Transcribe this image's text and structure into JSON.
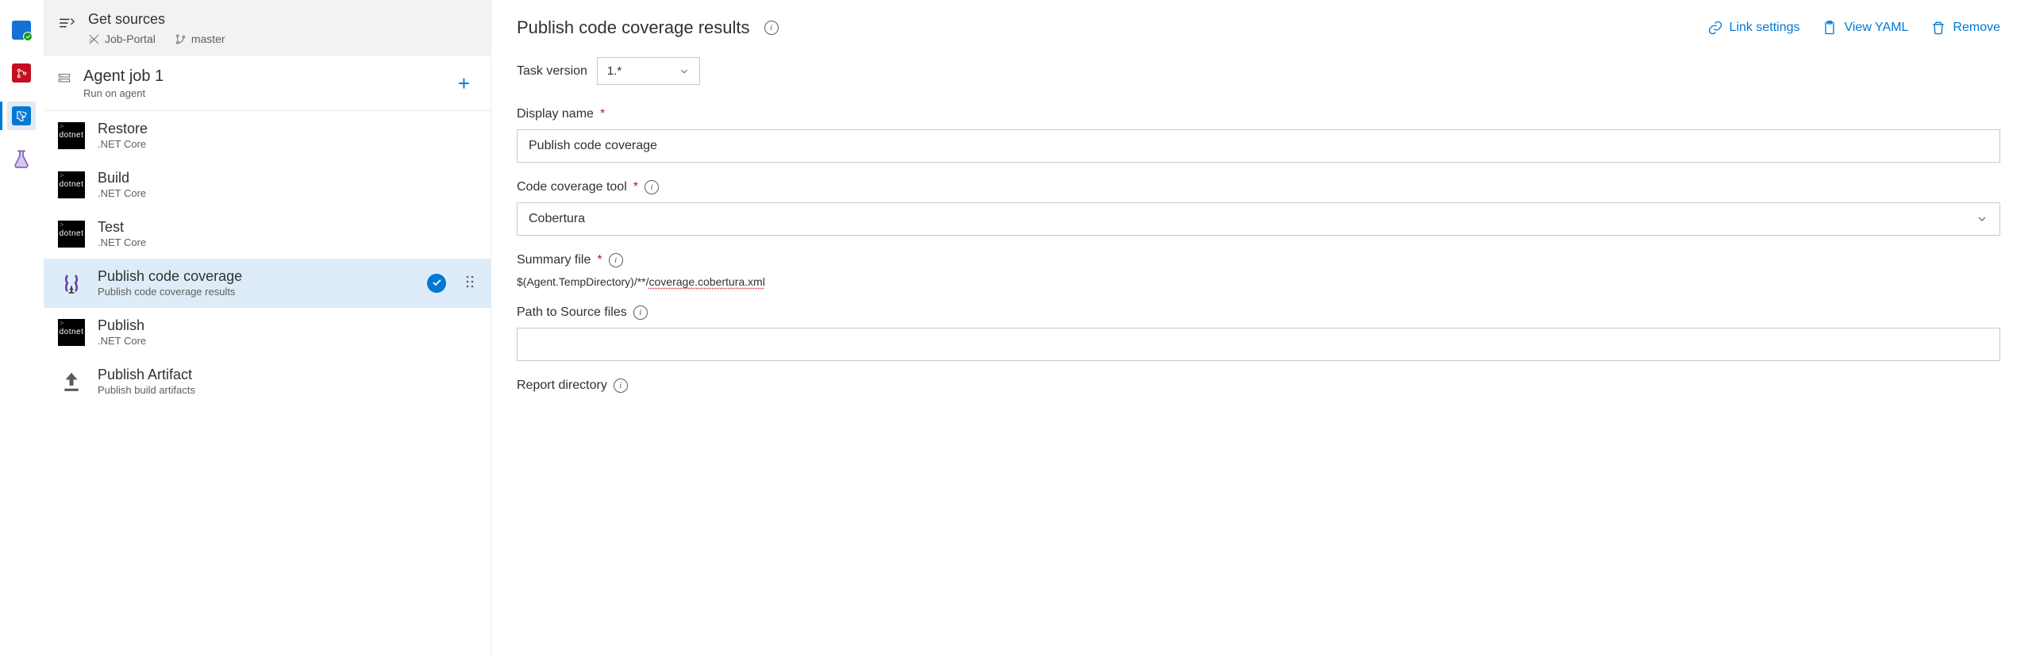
{
  "nav": {
    "items": [
      {
        "name": "overview"
      },
      {
        "name": "repos"
      },
      {
        "name": "pipelines"
      },
      {
        "name": "test-plans"
      }
    ]
  },
  "sources": {
    "title": "Get sources",
    "repo": "Job-Portal",
    "branch": "master"
  },
  "agentJob": {
    "title": "Agent job 1",
    "subtitle": "Run on agent"
  },
  "tasks": [
    {
      "title": "Restore",
      "subtitle": ".NET Core",
      "iconKind": "dotnet",
      "iconText": "dotnet"
    },
    {
      "title": "Build",
      "subtitle": ".NET Core",
      "iconKind": "dotnet",
      "iconText": "dotnet"
    },
    {
      "title": "Test",
      "subtitle": ".NET Core",
      "iconKind": "dotnet",
      "iconText": "dotnet"
    },
    {
      "title": "Publish code coverage",
      "subtitle": "Publish code coverage results",
      "iconKind": "codecov"
    },
    {
      "title": "Publish",
      "subtitle": ".NET Core",
      "iconKind": "dotnet",
      "iconText": "dotnet"
    },
    {
      "title": "Publish Artifact",
      "subtitle": "Publish build artifacts",
      "iconKind": "upload"
    }
  ],
  "selectedTaskIndex": 3,
  "detail": {
    "heading": "Publish code coverage results",
    "links": {
      "linkSettings": "Link settings",
      "viewYaml": "View YAML",
      "remove": "Remove"
    },
    "taskVersionLabel": "Task version",
    "taskVersionValue": "1.*",
    "fields": {
      "displayName": {
        "label": "Display name",
        "value": "Publish code coverage",
        "required": true
      },
      "coverageTool": {
        "label": "Code coverage tool",
        "value": "Cobertura",
        "required": true,
        "info": true
      },
      "summaryFile": {
        "label": "Summary file",
        "value": "$(Agent.TempDirectory)/**/",
        "valueErr": "coverage.cobertura.xml",
        "required": true,
        "info": true
      },
      "sourcePath": {
        "label": "Path to Source files",
        "value": "",
        "info": true
      },
      "reportDir": {
        "label": "Report directory",
        "value": "",
        "info": true
      }
    }
  }
}
